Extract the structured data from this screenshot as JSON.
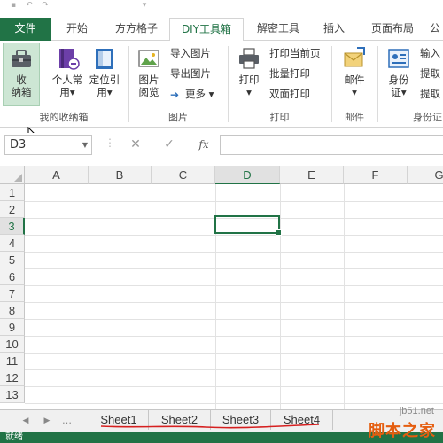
{
  "ribbon_tabs": [
    {
      "label": "文件"
    },
    {
      "label": "开始"
    },
    {
      "label": "方方格子"
    },
    {
      "label": "DIY工具箱"
    },
    {
      "label": "解密工具"
    },
    {
      "label": "插入"
    },
    {
      "label": "页面布局"
    },
    {
      "label": "公"
    }
  ],
  "groups": {
    "collect": {
      "label": "我的收纳箱",
      "collect_btn": {
        "line1": "收",
        "line2": "纳箱",
        "icon": "toolbox-icon"
      },
      "personal_btn": {
        "line1": "个人常",
        "line2": "用▾",
        "icon": "personal-book-icon"
      },
      "locate_btn": {
        "line1": "定位引",
        "line2": "用▾",
        "icon": "locate-panel-icon"
      }
    },
    "image": {
      "label": "图片",
      "preview_btn": {
        "line1": "图片",
        "line2": "阅览",
        "icon": "image-preview-icon"
      },
      "import_label": "导入图片",
      "export_label": "导出图片",
      "more_label": "更多 ▾"
    },
    "print": {
      "label": "打印",
      "print_btn": {
        "line1": "打印",
        "line2": "▾",
        "icon": "printer-icon"
      },
      "print_current": "打印当前页",
      "batch_print": "批量打印",
      "duplex_print": "双面打印"
    },
    "mail": {
      "label": "邮件",
      "mail_btn": {
        "line1": "邮件",
        "line2": "▾",
        "icon": "mail-icon"
      }
    },
    "id": {
      "label": "身份证",
      "id_btn": {
        "line1": "身份",
        "line2": "证▾",
        "icon": "id-card-icon"
      },
      "input_label": "输入",
      "extract1": "提取",
      "extract2": "提取"
    }
  },
  "formula_bar": {
    "name_box": "D3",
    "fx_label": "fx",
    "cancel_icon": "✕",
    "enter_icon": "✓",
    "value": ""
  },
  "columns": [
    "A",
    "B",
    "C",
    "D",
    "E",
    "F",
    "G"
  ],
  "rows": [
    "1",
    "2",
    "3",
    "4",
    "5",
    "6",
    "7",
    "8",
    "9",
    "10",
    "11",
    "12",
    "13"
  ],
  "selected_cell": "D3",
  "sheets": [
    "Sheet1",
    "Sheet2",
    "Sheet3",
    "Sheet4"
  ],
  "status": {
    "text": "就绪"
  },
  "watermark": {
    "url": "jb51.net",
    "text": "脚本之家"
  },
  "colors": {
    "accent": "#217346",
    "annotation": "#d62020",
    "watermark": "#e55e10"
  }
}
